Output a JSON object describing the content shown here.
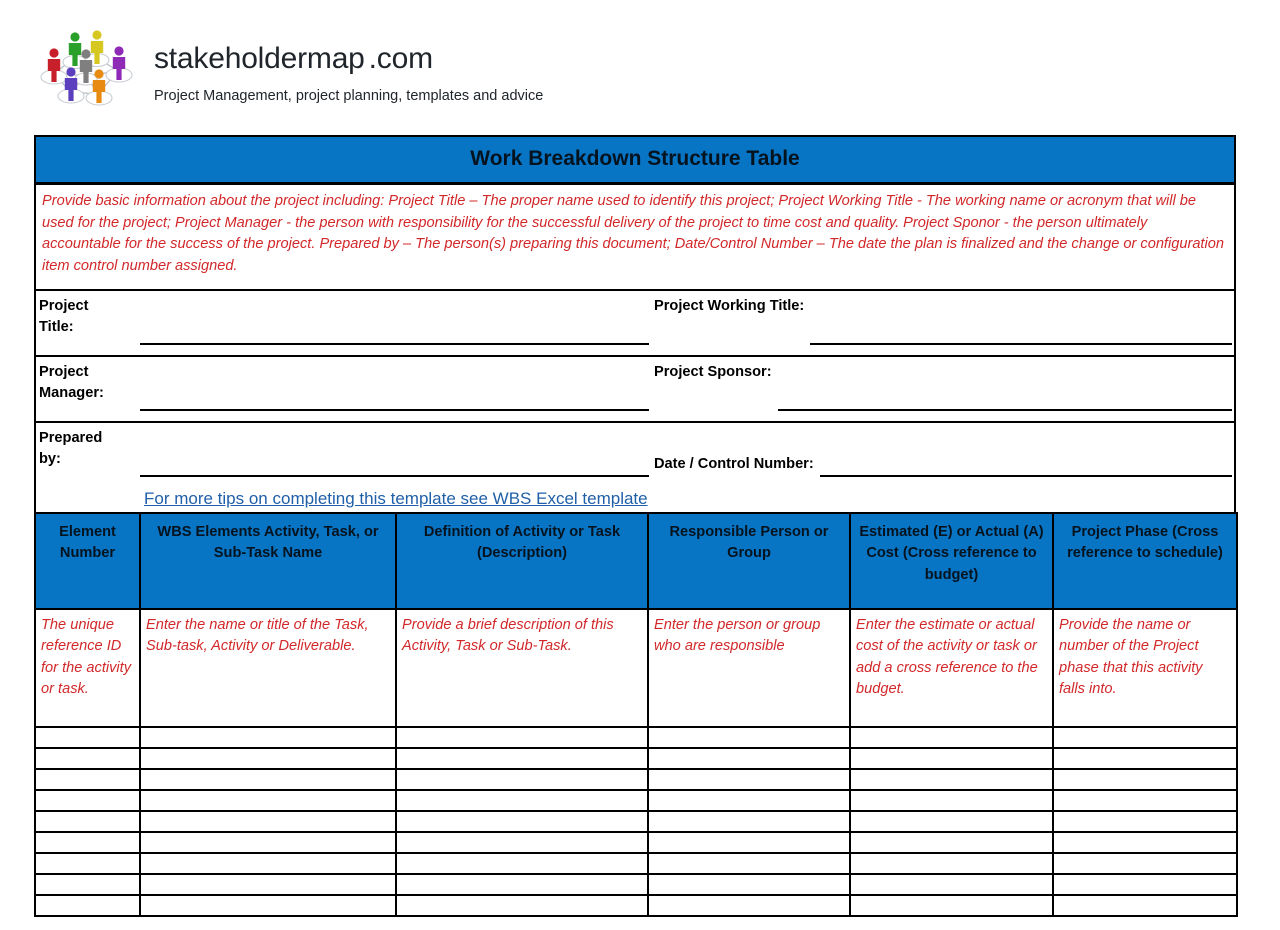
{
  "brand": {
    "logo_icon": "stakeholder-network-people-logo",
    "name": "stakeholdermap",
    "tld": ".com",
    "tagline": "Project Management, project planning, templates and advice",
    "logo_colors": [
      "#c8202a",
      "#2aa02a",
      "#7f7f7f",
      "#d6c820",
      "#8e2ab5",
      "#5b3fbf",
      "#e88b12"
    ]
  },
  "document": {
    "title": "Work Breakdown Structure Table",
    "title_bar_color": "#0874c4",
    "instruction_color": "#d2282a",
    "link_color": "#1f5fa8",
    "instructions": "Provide basic information about the project including: Project Title – The proper name used to identify this project; Project Working Title - The working name or acronym that will be used for the project;  Project Manager - the person with responsibility for the successful delivery of the project to time cost and quality. Project Sponor - the person ultimately accountable for the success of the project. Prepared by – The person(s) preparing this document; Date/Control Number – The date the plan is finalized and the change or configuration item control number assigned."
  },
  "project_info": {
    "rows": [
      {
        "left_label": "Project\nTitle:",
        "left_value": "",
        "right_label": "Project Working Title:",
        "right_value": ""
      },
      {
        "left_label": "Project\nManager:",
        "left_value": "",
        "right_label": "Project Sponsor:",
        "right_value": ""
      },
      {
        "left_label": "Prepared\nby:",
        "left_value": "",
        "right_label": "Date / Control Number:",
        "right_value": ""
      }
    ]
  },
  "tips_link": {
    "text": "For more tips on completing this template see WBS Excel template"
  },
  "wbs_table": {
    "headers": [
      "Element Number",
      "WBS Elements Activity, Task, or Sub-Task Name",
      "Definition of Activity or Task (Description)",
      "Responsible Person or Group",
      "Estimated (E) or Actual (A) Cost (Cross reference to budget)",
      "Project Phase (Cross reference to schedule)"
    ],
    "example_row": [
      "The unique reference ID for the activity or task.",
      "Enter the name or title of the Task, Sub-task, Activity or Deliverable.",
      "Provide a brief description of this Activity, Task or Sub-Task.",
      "Enter the person or group who are responsible",
      "Enter the estimate or actual cost of the activity or task or add a cross reference to the budget.",
      "Provide the name or number of the Project phase that this activity falls into."
    ],
    "blank_row_count": 9
  }
}
